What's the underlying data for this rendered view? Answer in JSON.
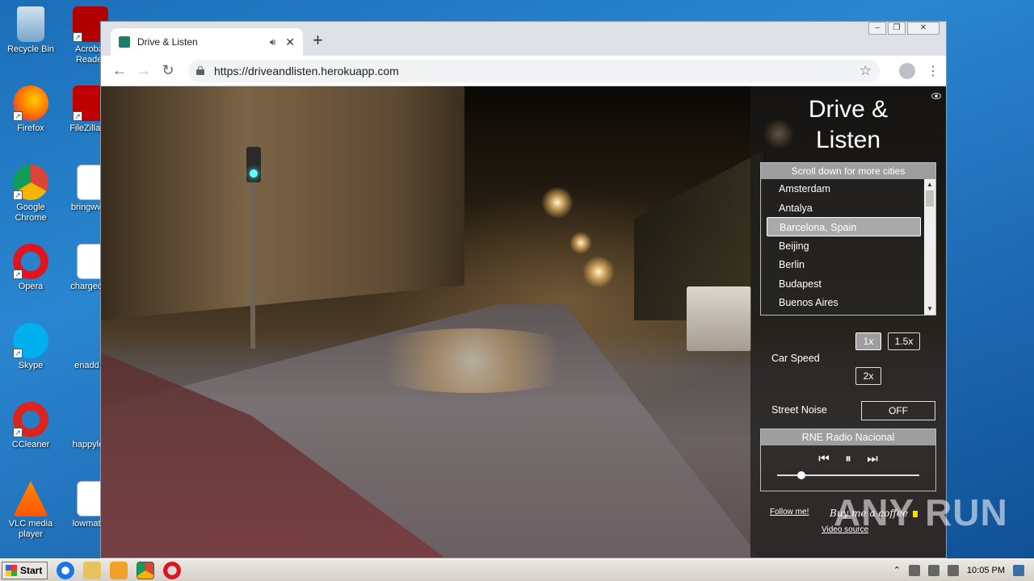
{
  "desktop": {
    "icons": [
      {
        "label": "Recycle Bin"
      },
      {
        "label": "Acrobat Reader"
      },
      {
        "label": "Firefox"
      },
      {
        "label": "FileZilla Cl"
      },
      {
        "label": "Google Chrome"
      },
      {
        "label": "bringwww"
      },
      {
        "label": "Opera"
      },
      {
        "label": "chargecivi"
      },
      {
        "label": "Skype"
      },
      {
        "label": "enadd.p"
      },
      {
        "label": "CCleaner"
      },
      {
        "label": "happylea"
      },
      {
        "label": "VLC media player"
      },
      {
        "label": "lowmatur"
      }
    ]
  },
  "browser": {
    "tab_title": "Drive & Listen",
    "new_tab": "+",
    "url": "https://driveandlisten.herokuapp.com"
  },
  "app": {
    "title_line1": "Drive &",
    "title_line2": "Listen",
    "cities_header": "Scroll down for more cities",
    "cities": [
      "Amsterdam",
      "Antalya",
      "Barcelona, Spain",
      "Beijing",
      "Berlin",
      "Budapest",
      "Buenos Aires"
    ],
    "selected_city": "Barcelona, Spain",
    "car_speed_label": "Car Speed",
    "speeds": [
      "1x",
      "1.5x",
      "2x"
    ],
    "active_speed": "1x",
    "street_noise_label": "Street Noise",
    "street_noise_value": "OFF",
    "radio_station": "RNE Radio Nacional",
    "volume_fraction": 0.14,
    "follow_me": "Follow me!",
    "buy_coffee": "Buy me a coffee",
    "video_source": "Video source"
  },
  "watermark": "ANY RUN",
  "taskbar": {
    "start": "Start",
    "clock": "10:05 PM"
  },
  "colors": {
    "desktop_blue": "#1b6fb8",
    "panel_bg": "#191919",
    "selected_gray": "#a9a9a9"
  }
}
